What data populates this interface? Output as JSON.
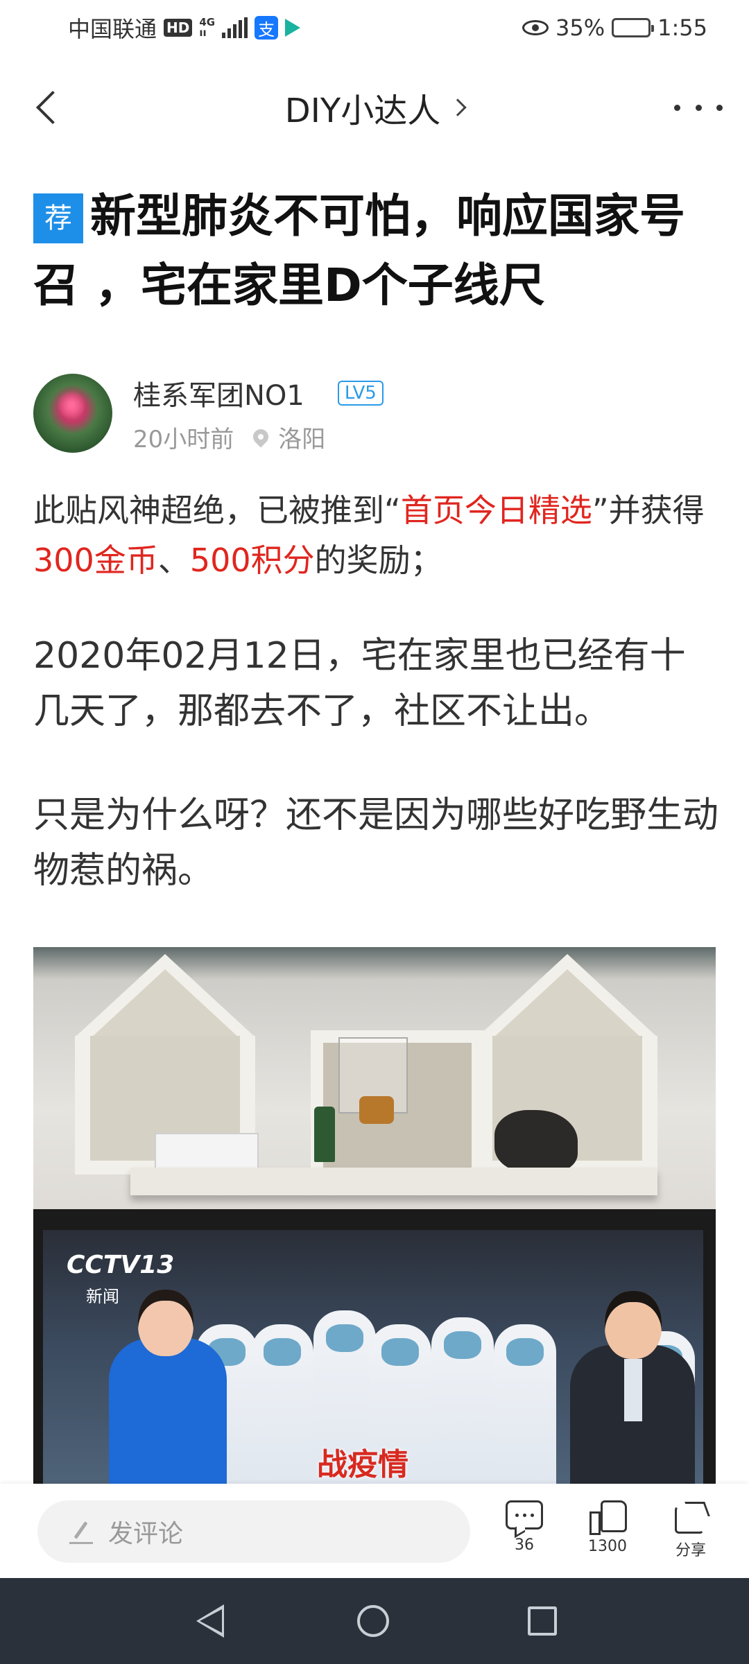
{
  "status_bar": {
    "carrier": "中国联通",
    "hd": "HD",
    "net_top": "4G",
    "net_bottom": "ıı",
    "alipay_glyph": "支",
    "battery_text": "35%",
    "battery_level": 0.35,
    "time": "1:55"
  },
  "nav": {
    "title": "DIY小达人"
  },
  "post": {
    "badge": "荐",
    "title": "新型肺炎不可怕，响应国家号召 ，宅在家里D个子线尺"
  },
  "author": {
    "name": "桂系军团NO1",
    "level": "LV5",
    "time_ago": "20小时前",
    "location": "洛阳"
  },
  "notice": {
    "part1": "此贴风神超绝，已被推到“",
    "highlight1": "首页今日精选",
    "part2": "”并获得",
    "highlight2": "300金币",
    "part3": "、",
    "highlight3": "500积分",
    "part4": "的奖励；"
  },
  "body": {
    "paragraph1": "2020年02月12日，宅在家里也已经有十几天了，那都去不了，社区不让出。",
    "paragraph2": "只是为什么呀？还不是因为哪些好吃野生动物惹的祸。"
  },
  "photo": {
    "tv_logo": "CCTV13",
    "tv_sub": "新闻",
    "tv_caption": "战疫情"
  },
  "bottom_bar": {
    "comment_placeholder": "发评论",
    "comment_count": "36",
    "like_count": "1300",
    "share_label": "分享"
  },
  "colors": {
    "highlight": "#e0261f",
    "badge_blue": "#1e8fe8",
    "system_nav": "#2a313a"
  }
}
